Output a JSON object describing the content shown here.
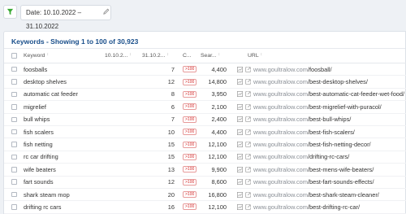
{
  "filter": {
    "icon": "filter-icon",
    "date_label": "Date: 10.10.2022 – 31.10.2022",
    "edit_icon": "pencil-icon"
  },
  "keywords": {
    "title": "Keywords - Showing 1 to 100 of 30,923",
    "columns": {
      "keyword": "Keyword",
      "date1": "10.10.2...",
      "date2": "31.10.2...",
      "change": "C...",
      "search_volume": "Sear...",
      "url": "URL"
    },
    "rows": [
      {
        "keyword": "foosballs",
        "d1": "",
        "d2": "7",
        "change": ">100",
        "sv": "4,400",
        "host": "www.goultralow.com",
        "path": "/foosball/"
      },
      {
        "keyword": "desktop shelves",
        "d1": "",
        "d2": "12",
        "change": ">100",
        "sv": "14,800",
        "host": "www.goultralow.com",
        "path": "/best-desktop-shelves/"
      },
      {
        "keyword": "automatic cat feeder",
        "d1": "",
        "d2": "8",
        "change": ">100",
        "sv": "3,950",
        "host": "www.goultralow.com",
        "path": "/best-automatic-cat-feeder-wet-food/"
      },
      {
        "keyword": "migrelief",
        "d1": "",
        "d2": "6",
        "change": ">100",
        "sv": "2,100",
        "host": "www.goultralow.com",
        "path": "/best-migrelief-with-puracol/"
      },
      {
        "keyword": "bull whips",
        "d1": "",
        "d2": "7",
        "change": ">100",
        "sv": "2,400",
        "host": "www.goultralow.com",
        "path": "/best-bull-whips/"
      },
      {
        "keyword": "fish scalers",
        "d1": "",
        "d2": "10",
        "change": ">100",
        "sv": "4,400",
        "host": "www.goultralow.com",
        "path": "/best-fish-scalers/"
      },
      {
        "keyword": "fish netting",
        "d1": "",
        "d2": "15",
        "change": ">100",
        "sv": "12,100",
        "host": "www.goultralow.com",
        "path": "/best-fish-netting-decor/"
      },
      {
        "keyword": "rc car drifting",
        "d1": "",
        "d2": "15",
        "change": ">100",
        "sv": "12,100",
        "host": "www.goultralow.com",
        "path": "/drifting-rc-cars/"
      },
      {
        "keyword": "wife beaters",
        "d1": "",
        "d2": "13",
        "change": ">100",
        "sv": "9,900",
        "host": "www.goultralow.com",
        "path": "/best-mens-wife-beaters/"
      },
      {
        "keyword": "fart sounds",
        "d1": "",
        "d2": "12",
        "change": ">100",
        "sv": "8,600",
        "host": "www.goultralow.com",
        "path": "/best-fart-sounds-effects/"
      },
      {
        "keyword": "shark steam mop",
        "d1": "",
        "d2": "20",
        "change": ">100",
        "sv": "16,800",
        "host": "www.goultralow.com",
        "path": "/best-shark-steam-cleaner/"
      },
      {
        "keyword": "drifting rc cars",
        "d1": "",
        "d2": "16",
        "change": ">100",
        "sv": "12,100",
        "host": "www.goultralow.com",
        "path": "/best-drifting-rc-car/"
      }
    ]
  },
  "colors": {
    "title": "#1a4f8b",
    "badge": "#d52a2a",
    "filter_icon": "#3aaa35"
  }
}
